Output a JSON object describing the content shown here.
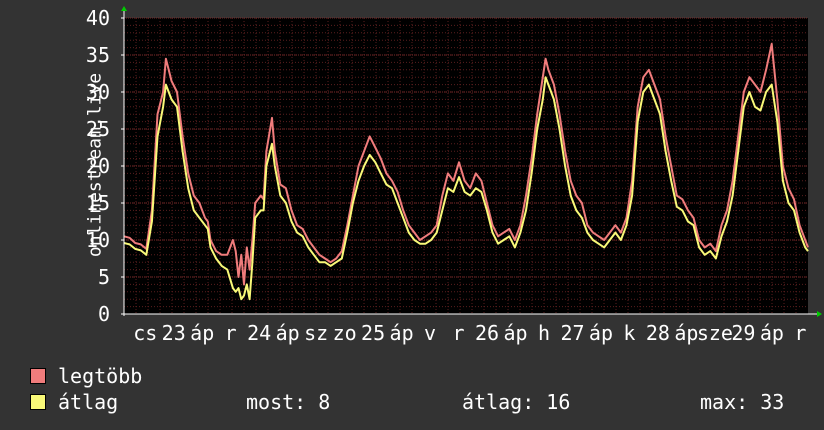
{
  "chart_data": {
    "type": "line",
    "ylabel": "onlinestream.live",
    "ylim": [
      0,
      40
    ],
    "y_ticks": [
      0,
      5,
      10,
      15,
      20,
      25,
      30,
      35,
      40
    ],
    "grid": true,
    "x_tick_labels": [
      "cs",
      "23",
      "áp",
      "r",
      "24",
      "áp",
      "sz",
      "zo",
      "25",
      "áp",
      "v",
      "r",
      "26",
      "áp",
      "h",
      "27",
      "áp",
      "k",
      "28",
      "áp",
      "sze",
      "29",
      "áp",
      "r"
    ],
    "series": [
      {
        "name": "legtöbb",
        "color": "#f07c7c",
        "keypoints": [
          [
            0,
            10.5
          ],
          [
            2,
            10.3
          ],
          [
            4,
            9.6
          ],
          [
            6,
            9.4
          ],
          [
            8,
            8.8
          ],
          [
            10,
            14
          ],
          [
            12,
            27
          ],
          [
            14,
            30
          ],
          [
            15,
            34.5
          ],
          [
            16,
            33
          ],
          [
            17,
            31.5
          ],
          [
            19,
            30
          ],
          [
            21,
            24
          ],
          [
            23,
            19
          ],
          [
            25,
            16
          ],
          [
            27,
            15
          ],
          [
            29,
            13
          ],
          [
            30,
            12.5
          ],
          [
            31,
            10
          ],
          [
            33,
            8.5
          ],
          [
            35,
            8
          ],
          [
            37,
            8
          ],
          [
            39,
            10
          ],
          [
            40,
            8.5
          ],
          [
            41,
            5
          ],
          [
            42,
            8
          ],
          [
            43,
            4
          ],
          [
            44,
            9
          ],
          [
            45,
            6
          ],
          [
            46,
            10
          ],
          [
            47,
            15
          ],
          [
            49,
            16
          ],
          [
            50,
            15.5
          ],
          [
            51,
            22
          ],
          [
            53,
            26.5
          ],
          [
            54,
            22
          ],
          [
            56,
            17.5
          ],
          [
            58,
            17
          ],
          [
            60,
            14
          ],
          [
            62,
            12
          ],
          [
            64,
            11.5
          ],
          [
            66,
            10
          ],
          [
            68,
            9
          ],
          [
            70,
            8
          ],
          [
            72,
            7.5
          ],
          [
            74,
            7
          ],
          [
            76,
            7.5
          ],
          [
            78,
            8.5
          ],
          [
            80,
            12
          ],
          [
            82,
            16
          ],
          [
            84,
            20
          ],
          [
            86,
            22
          ],
          [
            88,
            24
          ],
          [
            90,
            22.5
          ],
          [
            92,
            21
          ],
          [
            94,
            19
          ],
          [
            96,
            18
          ],
          [
            98,
            16.5
          ],
          [
            100,
            14
          ],
          [
            102,
            12
          ],
          [
            104,
            11
          ],
          [
            106,
            10
          ],
          [
            108,
            10.5
          ],
          [
            110,
            11
          ],
          [
            112,
            12
          ],
          [
            114,
            16
          ],
          [
            116,
            19
          ],
          [
            118,
            18
          ],
          [
            120,
            20.5
          ],
          [
            122,
            18
          ],
          [
            124,
            17
          ],
          [
            126,
            19
          ],
          [
            128,
            18
          ],
          [
            130,
            15
          ],
          [
            132,
            12
          ],
          [
            134,
            10.5
          ],
          [
            136,
            11
          ],
          [
            138,
            11.5
          ],
          [
            140,
            10
          ],
          [
            142,
            12
          ],
          [
            144,
            16
          ],
          [
            146,
            21
          ],
          [
            148,
            27
          ],
          [
            150,
            32
          ],
          [
            151,
            34.5
          ],
          [
            152,
            33
          ],
          [
            154,
            31
          ],
          [
            156,
            27
          ],
          [
            158,
            22
          ],
          [
            160,
            18
          ],
          [
            162,
            16
          ],
          [
            164,
            15
          ],
          [
            166,
            12
          ],
          [
            168,
            11
          ],
          [
            170,
            10.5
          ],
          [
            172,
            10
          ],
          [
            174,
            11
          ],
          [
            176,
            12
          ],
          [
            178,
            11
          ],
          [
            180,
            13
          ],
          [
            182,
            18
          ],
          [
            184,
            28
          ],
          [
            186,
            32
          ],
          [
            188,
            33
          ],
          [
            190,
            31
          ],
          [
            192,
            29
          ],
          [
            194,
            24
          ],
          [
            196,
            20
          ],
          [
            198,
            16
          ],
          [
            200,
            15.5
          ],
          [
            202,
            14
          ],
          [
            204,
            13
          ],
          [
            206,
            10
          ],
          [
            208,
            9
          ],
          [
            210,
            9.5
          ],
          [
            212,
            8.5
          ],
          [
            214,
            12
          ],
          [
            216,
            14
          ],
          [
            218,
            18
          ],
          [
            220,
            24
          ],
          [
            222,
            30
          ],
          [
            224,
            32
          ],
          [
            226,
            31
          ],
          [
            228,
            30
          ],
          [
            230,
            33
          ],
          [
            232,
            36.5
          ],
          [
            234,
            29
          ],
          [
            236,
            20
          ],
          [
            238,
            17
          ],
          [
            240,
            15.5
          ],
          [
            242,
            12
          ],
          [
            244,
            10
          ],
          [
            245,
            9
          ]
        ]
      },
      {
        "name": "átlag",
        "color": "#f9f978",
        "keypoints": [
          [
            0,
            9.6
          ],
          [
            2,
            9.4
          ],
          [
            4,
            8.8
          ],
          [
            6,
            8.6
          ],
          [
            8,
            8
          ],
          [
            10,
            12.5
          ],
          [
            12,
            24
          ],
          [
            14,
            28
          ],
          [
            15,
            31
          ],
          [
            16,
            30
          ],
          [
            17,
            29
          ],
          [
            19,
            28
          ],
          [
            21,
            22
          ],
          [
            23,
            17
          ],
          [
            25,
            14
          ],
          [
            27,
            13
          ],
          [
            29,
            12
          ],
          [
            30,
            11.5
          ],
          [
            31,
            9
          ],
          [
            33,
            7.5
          ],
          [
            35,
            6.5
          ],
          [
            37,
            6
          ],
          [
            39,
            3.5
          ],
          [
            40,
            3
          ],
          [
            41,
            3.5
          ],
          [
            42,
            2
          ],
          [
            43,
            2.5
          ],
          [
            44,
            4
          ],
          [
            45,
            2
          ],
          [
            46,
            7
          ],
          [
            47,
            13
          ],
          [
            49,
            14
          ],
          [
            50,
            14
          ],
          [
            51,
            20
          ],
          [
            53,
            23
          ],
          [
            54,
            20
          ],
          [
            56,
            16
          ],
          [
            58,
            15
          ],
          [
            60,
            12.5
          ],
          [
            62,
            11
          ],
          [
            64,
            10.5
          ],
          [
            66,
            9
          ],
          [
            68,
            8
          ],
          [
            70,
            7
          ],
          [
            72,
            7
          ],
          [
            74,
            6.5
          ],
          [
            76,
            7
          ],
          [
            78,
            7.5
          ],
          [
            80,
            11
          ],
          [
            82,
            15
          ],
          [
            84,
            18
          ],
          [
            86,
            20
          ],
          [
            88,
            21.5
          ],
          [
            90,
            20.5
          ],
          [
            92,
            19
          ],
          [
            94,
            17.5
          ],
          [
            96,
            17
          ],
          [
            98,
            15
          ],
          [
            100,
            13
          ],
          [
            102,
            11
          ],
          [
            104,
            10
          ],
          [
            106,
            9.5
          ],
          [
            108,
            9.5
          ],
          [
            110,
            10
          ],
          [
            112,
            11
          ],
          [
            114,
            14
          ],
          [
            116,
            17
          ],
          [
            118,
            16.5
          ],
          [
            120,
            18.5
          ],
          [
            122,
            16.5
          ],
          [
            124,
            16
          ],
          [
            126,
            17
          ],
          [
            128,
            16.5
          ],
          [
            130,
            14
          ],
          [
            132,
            11
          ],
          [
            134,
            9.5
          ],
          [
            136,
            10
          ],
          [
            138,
            10.5
          ],
          [
            140,
            9
          ],
          [
            142,
            11
          ],
          [
            144,
            14
          ],
          [
            146,
            19
          ],
          [
            148,
            25
          ],
          [
            150,
            29
          ],
          [
            151,
            32
          ],
          [
            152,
            31
          ],
          [
            154,
            29
          ],
          [
            156,
            25
          ],
          [
            158,
            20
          ],
          [
            160,
            16
          ],
          [
            162,
            14
          ],
          [
            164,
            13
          ],
          [
            166,
            11
          ],
          [
            168,
            10
          ],
          [
            170,
            9.5
          ],
          [
            172,
            9
          ],
          [
            174,
            10
          ],
          [
            176,
            11
          ],
          [
            178,
            10
          ],
          [
            180,
            12
          ],
          [
            182,
            16
          ],
          [
            184,
            26
          ],
          [
            186,
            30
          ],
          [
            188,
            31
          ],
          [
            190,
            29
          ],
          [
            192,
            27
          ],
          [
            194,
            22
          ],
          [
            196,
            18
          ],
          [
            198,
            14.5
          ],
          [
            200,
            14
          ],
          [
            202,
            12.5
          ],
          [
            204,
            12
          ],
          [
            206,
            9
          ],
          [
            208,
            8
          ],
          [
            210,
            8.5
          ],
          [
            212,
            7.5
          ],
          [
            214,
            10.5
          ],
          [
            216,
            12.5
          ],
          [
            218,
            16
          ],
          [
            220,
            22
          ],
          [
            222,
            28
          ],
          [
            224,
            30
          ],
          [
            226,
            28
          ],
          [
            228,
            27.5
          ],
          [
            230,
            30
          ],
          [
            232,
            31
          ],
          [
            234,
            26
          ],
          [
            236,
            18
          ],
          [
            238,
            15
          ],
          [
            240,
            14
          ],
          [
            242,
            11
          ],
          [
            244,
            9
          ],
          [
            245,
            8.5
          ]
        ]
      }
    ]
  },
  "stats": {
    "now": "most: 8",
    "avg": "átlag: 16",
    "max": "max: 33"
  }
}
